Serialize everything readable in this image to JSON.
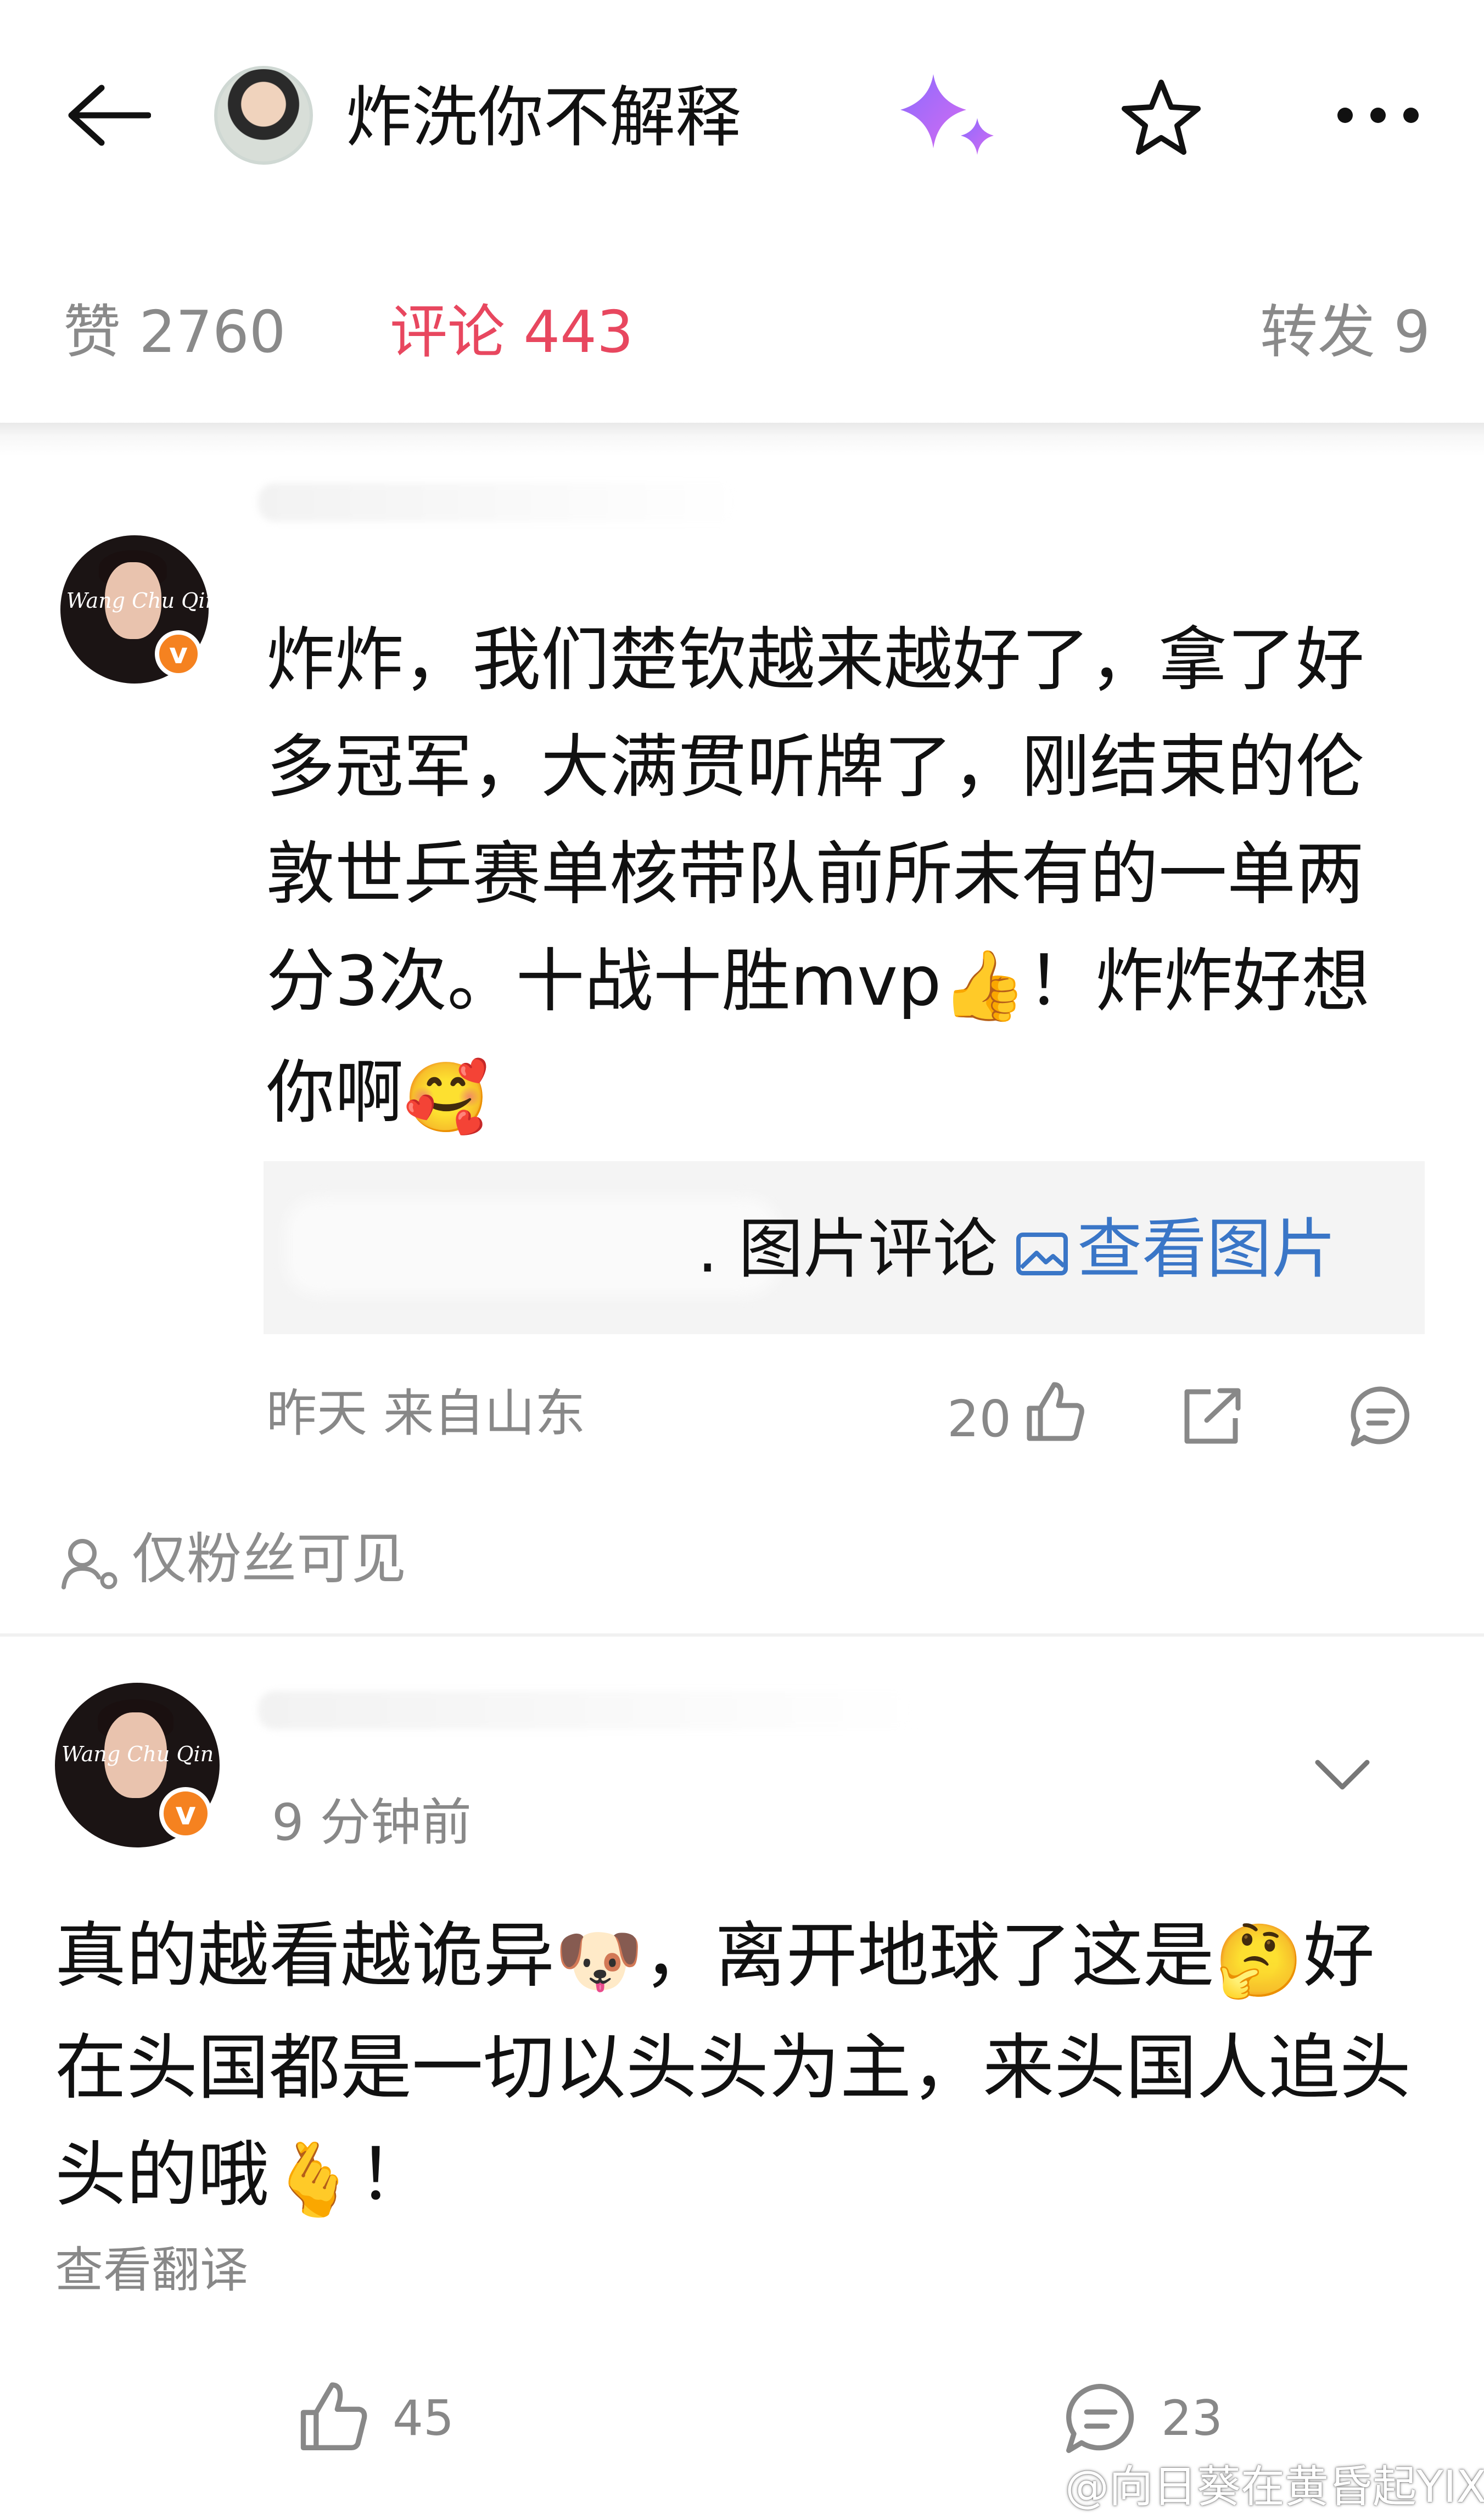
{
  "header": {
    "title": "炸洗你不解释",
    "back_icon": "arrow-left-icon",
    "sparkle_icon": "ai-sparkle-icon",
    "star_icon": "star-outline-icon",
    "more_icon": "more-dots-icon"
  },
  "tabs": [
    {
      "label": "赞 2760",
      "active": false
    },
    {
      "label": "评论 443",
      "active": true
    },
    {
      "label": "转发 9",
      "active": false
    }
  ],
  "colors": {
    "accent": "#e8475f",
    "link": "#3a76c7",
    "badge": "#f58220",
    "muted": "#888888"
  },
  "comment1": {
    "avatar_text": "Wang Chu Qin",
    "badge": "v",
    "text_before_thumb": "炸炸，我们楚钦越来越好了，拿了好多冠军，大满贯听牌了，刚结束的伦敦世乒赛单核带队前所未有的一单两分3次。十战十胜mvp",
    "emoji_thumb": "👍",
    "text_middle": "！炸炸好想你啊",
    "emoji_heart": "🥰",
    "image_label": ". 图片评论",
    "image_link": "查看图片",
    "time": "昨天  来自山东",
    "likes": "20"
  },
  "fans_only": "仅粉丝可见",
  "comment2": {
    "avatar_text": "Wang Chu Qin",
    "badge": "v",
    "time": "9 分钟前",
    "text_1": "真的越看越诡异",
    "emoji_dog": "🐶",
    "text_2": "，离开地球了这是",
    "emoji_think": "🤔",
    "text_3": "好在头国都是一切以头头为主，来头国人追头头的哦",
    "emoji_finger": "🫰",
    "text_4": "！",
    "translate": "查看翻译",
    "likes": "45",
    "comments": "23"
  },
  "watermark": "@向日葵在黄昏起YIX"
}
